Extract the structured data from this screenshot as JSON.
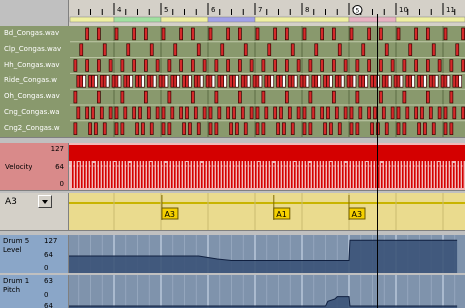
{
  "ruler": {
    "measures": [
      "4",
      "5",
      "6",
      "7",
      "8",
      "9",
      "10",
      "11"
    ],
    "playhead_marker": "5",
    "loop_segments": [
      {
        "color": "#f0f0a0"
      },
      {
        "color": "#a0e0a0"
      },
      {
        "color": "#f0f0a0"
      },
      {
        "color": "#a0a0e8"
      },
      {
        "color": "#f0f0a0"
      },
      {
        "color": "#e8b0c0"
      },
      {
        "color": "#f0f0a0"
      }
    ]
  },
  "drum_lanes": [
    {
      "name": "Bd_Congas.wav"
    },
    {
      "name": "Clp_Congas.wav"
    },
    {
      "name": "Hh_Congas.wav"
    },
    {
      "name": "Ride_Congas.w"
    },
    {
      "name": "Oh_Congas.wav"
    },
    {
      "name": "Cng_Congas.wa"
    },
    {
      "name": "Cng2_Congas.w"
    }
  ],
  "colors": {
    "lane_bg": "#89996d",
    "lane_text": "#ffffff",
    "hit_fill": "#d52a2a",
    "hit_outline": "#3a0000",
    "white_hit": "#ffffff",
    "velocity_bg": "#f2b8b8",
    "velocity_bar": "#d40000",
    "chord_bg": "#eadb8e",
    "chord_line": "#c8b400",
    "chord_box": "#f5d000",
    "automation_bg": "#7f93ac",
    "automation_fill": "#3b5378",
    "automation_line": "#102040"
  },
  "velocity": {
    "title": "Velocity",
    "max": "127",
    "mid": "64",
    "min": "0"
  },
  "chord_lane": {
    "selector_value": "A3",
    "events": [
      {
        "label": "A3",
        "beat": 5.02
      },
      {
        "label": "A1",
        "beat": 7.4
      },
      {
        "label": "A3",
        "beat": 9.0
      }
    ]
  },
  "automation": [
    {
      "name_line1": "Drum 5",
      "name_line2": "Level",
      "max": "127",
      "mid": "64",
      "min": "0",
      "points": [
        [
          3.0,
          64
        ],
        [
          5.8,
          64
        ],
        [
          6.2,
          52
        ],
        [
          6.5,
          46
        ],
        [
          9.0,
          46
        ],
        [
          9.02,
          127
        ],
        [
          11.3,
          127
        ]
      ]
    },
    {
      "name_line1": "Drum 1",
      "name_line2": "Pitch",
      "max": "63",
      "mid": "0",
      "min": "64",
      "points": [
        [
          3.0,
          -60
        ],
        [
          8.5,
          -60
        ],
        [
          8.55,
          -40
        ],
        [
          8.7,
          -30
        ],
        [
          8.75,
          -20
        ],
        [
          9.0,
          -20
        ],
        [
          9.02,
          -60
        ],
        [
          11.3,
          -60
        ]
      ]
    }
  ],
  "playhead_beat": 9.18
}
